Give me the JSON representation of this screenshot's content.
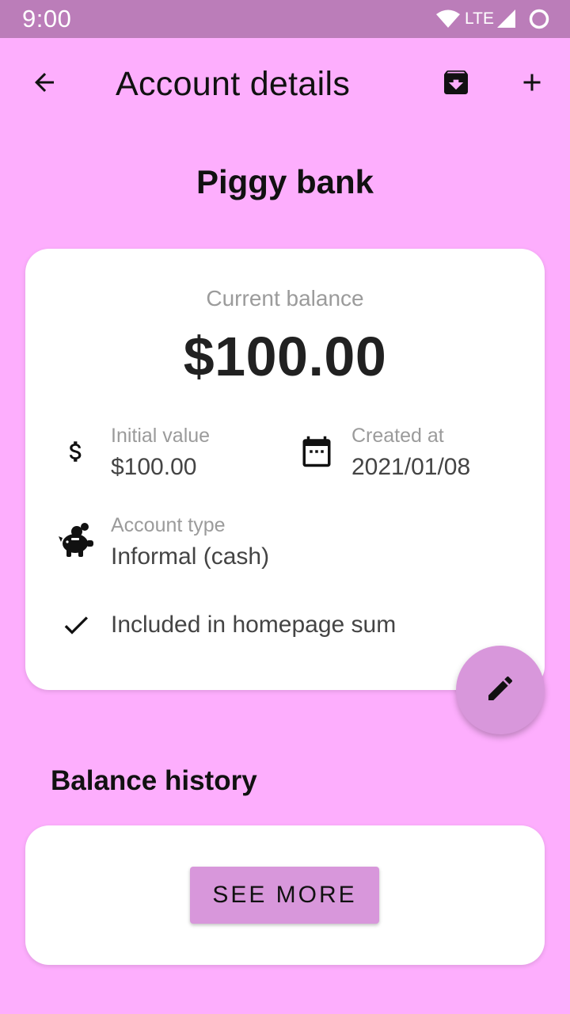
{
  "status_bar": {
    "time": "9:00",
    "network": "LTE",
    "icons": [
      "wifi-icon",
      "cell-signal-icon",
      "battery-icon"
    ]
  },
  "app_bar": {
    "title": "Account details",
    "icons": [
      "back-arrow-icon",
      "archive-icon",
      "add-icon"
    ]
  },
  "account": {
    "name": "Piggy bank"
  },
  "details_card": {
    "balance_label": "Current balance",
    "balance_value": "$100.00",
    "initial_value_label": "Initial value",
    "initial_value": "$100.00",
    "created_at_label": "Created at",
    "created_at": "2021/01/08",
    "account_type_label": "Account type",
    "account_type": "Informal (cash)",
    "homepage_sum_text": "Included in homepage sum",
    "icons": [
      "dollar-icon",
      "calendar-icon",
      "piggy-bank-icon",
      "check-icon"
    ]
  },
  "fab": {
    "icon": "edit-pencil-icon"
  },
  "balance_history": {
    "title": "Balance history",
    "button_label": "SEE MORE"
  },
  "colors": {
    "background": "#FDAEFD",
    "status_bar": "#BB7DB9",
    "accent": "#D897DB",
    "card": "#FFFFFF"
  }
}
